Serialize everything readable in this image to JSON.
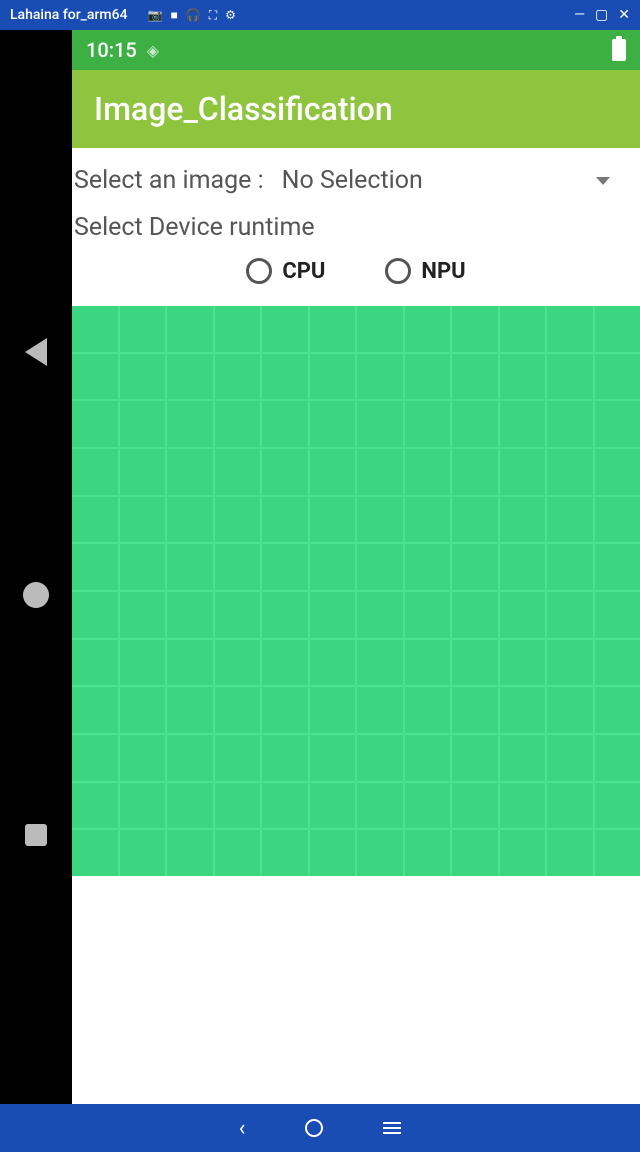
{
  "window": {
    "title": "Lahaina for_arm64",
    "icons": {
      "camera": "camera-icon",
      "video": "video-icon",
      "headphone": "headphone-icon",
      "fullscreen": "fullscreen-icon",
      "settings": "settings-icon"
    },
    "controls": {
      "minimize": "—",
      "maximize": "▢",
      "close": "✕"
    }
  },
  "status": {
    "time": "10:15"
  },
  "app": {
    "title": "Image_Classification"
  },
  "select_image": {
    "label": "Select an image :",
    "value": "No Selection"
  },
  "runtime": {
    "label": "Select Device runtime",
    "options": {
      "cpu": "CPU",
      "npu": "NPU"
    }
  },
  "colors": {
    "emulator_chrome": "#1a4db3",
    "status_bar": "#3cb043",
    "app_bar": "#8fc53e",
    "preview_tile": "#3dd680",
    "preview_bg": "#4be38e"
  }
}
